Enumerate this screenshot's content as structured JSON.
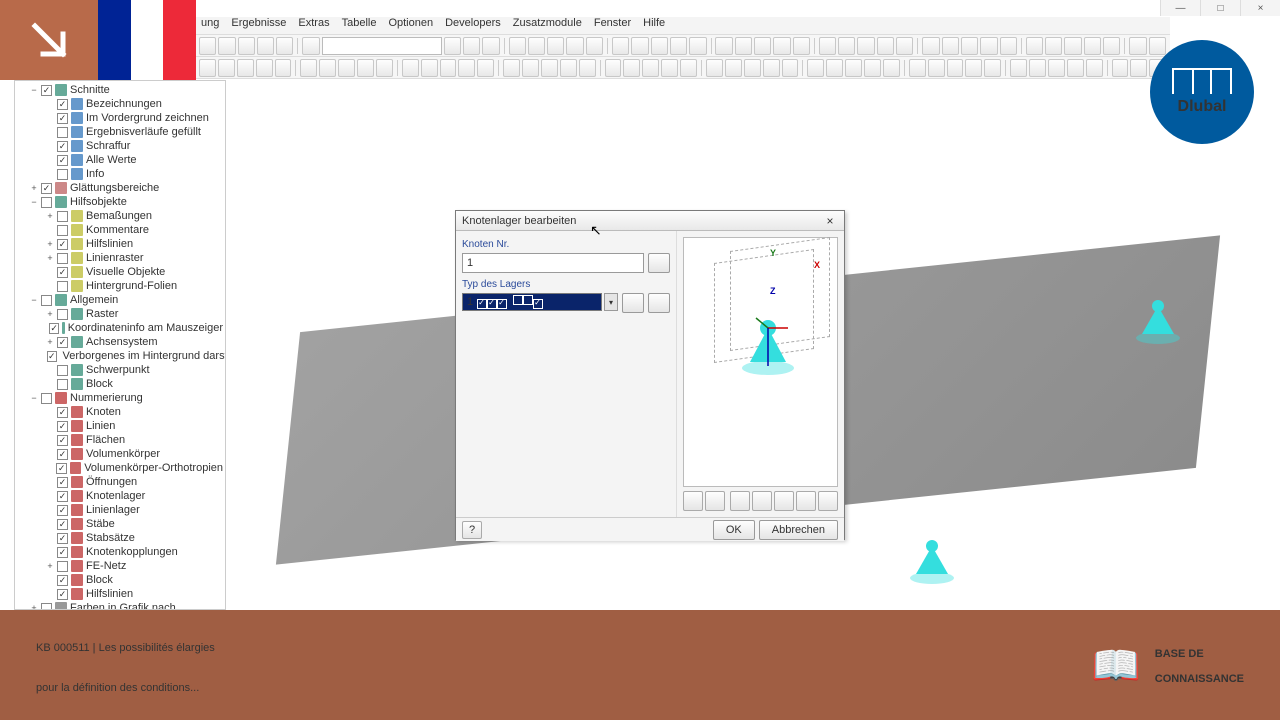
{
  "menu": [
    "ung",
    "Ergebnisse",
    "Extras",
    "Tabelle",
    "Optionen",
    "Developers",
    "Zusatzmodule",
    "Fenster",
    "Hilfe"
  ],
  "tree": [
    {
      "l": 1,
      "exp": "−",
      "chk": true,
      "ic": "ic-a",
      "label": "Schnitte"
    },
    {
      "l": 2,
      "chk": true,
      "ic": "ic-b",
      "label": "Bezeichnungen"
    },
    {
      "l": 2,
      "chk": true,
      "ic": "ic-b",
      "label": "Im Vordergrund zeichnen"
    },
    {
      "l": 2,
      "chk": false,
      "ic": "ic-b",
      "label": "Ergebnisverläufe gefüllt"
    },
    {
      "l": 2,
      "chk": true,
      "ic": "ic-b",
      "label": "Schraffur"
    },
    {
      "l": 2,
      "chk": true,
      "ic": "ic-b",
      "label": "Alle Werte"
    },
    {
      "l": 2,
      "chk": false,
      "ic": "ic-b",
      "label": "Info"
    },
    {
      "l": 1,
      "exp": "+",
      "chk": true,
      "ic": "ic-c",
      "label": "Glättungsbereiche"
    },
    {
      "l": 1,
      "exp": "−",
      "chk": false,
      "ic": "ic-a",
      "label": "Hilfsobjekte"
    },
    {
      "l": 2,
      "exp": "+",
      "chk": false,
      "ic": "ic-d",
      "label": "Bemaßungen"
    },
    {
      "l": 2,
      "exp": "",
      "chk": false,
      "ic": "ic-d",
      "label": "Kommentare"
    },
    {
      "l": 2,
      "exp": "+",
      "chk": true,
      "ic": "ic-d",
      "label": "Hilfslinien"
    },
    {
      "l": 2,
      "exp": "+",
      "chk": false,
      "ic": "ic-d",
      "label": "Linienraster"
    },
    {
      "l": 2,
      "exp": "",
      "chk": true,
      "ic": "ic-d",
      "label": "Visuelle Objekte"
    },
    {
      "l": 2,
      "exp": "",
      "chk": false,
      "ic": "ic-d",
      "label": "Hintergrund-Folien"
    },
    {
      "l": 1,
      "exp": "−",
      "chk": false,
      "ic": "ic-a",
      "label": "Allgemein"
    },
    {
      "l": 2,
      "exp": "+",
      "chk": false,
      "ic": "ic-a",
      "label": "Raster"
    },
    {
      "l": 2,
      "exp": "",
      "chk": true,
      "ic": "ic-a",
      "label": "Koordinateninfo am Mauszeiger"
    },
    {
      "l": 2,
      "exp": "+",
      "chk": true,
      "ic": "ic-a",
      "label": "Achsensystem"
    },
    {
      "l": 2,
      "exp": "",
      "chk": true,
      "ic": "ic-a",
      "label": "Verborgenes im Hintergrund darstelle"
    },
    {
      "l": 2,
      "exp": "",
      "chk": false,
      "ic": "ic-a",
      "label": "Schwerpunkt"
    },
    {
      "l": 2,
      "exp": "",
      "chk": false,
      "ic": "ic-a",
      "label": "Block"
    },
    {
      "l": 1,
      "exp": "−",
      "chk": false,
      "ic": "ic-n",
      "label": "Nummerierung"
    },
    {
      "l": 2,
      "chk": true,
      "ic": "ic-n",
      "label": "Knoten"
    },
    {
      "l": 2,
      "chk": true,
      "ic": "ic-n",
      "label": "Linien"
    },
    {
      "l": 2,
      "chk": true,
      "ic": "ic-n",
      "label": "Flächen"
    },
    {
      "l": 2,
      "chk": true,
      "ic": "ic-n",
      "label": "Volumenkörper"
    },
    {
      "l": 2,
      "chk": true,
      "ic": "ic-n",
      "label": "Volumenkörper-Orthotropien"
    },
    {
      "l": 2,
      "chk": true,
      "ic": "ic-n",
      "label": "Öffnungen"
    },
    {
      "l": 2,
      "chk": true,
      "ic": "ic-n",
      "label": "Knotenlager"
    },
    {
      "l": 2,
      "chk": true,
      "ic": "ic-n",
      "label": "Linienlager"
    },
    {
      "l": 2,
      "chk": true,
      "ic": "ic-n",
      "label": "Stäbe"
    },
    {
      "l": 2,
      "chk": true,
      "ic": "ic-n",
      "label": "Stabsätze"
    },
    {
      "l": 2,
      "chk": true,
      "ic": "ic-n",
      "label": "Knotenkopplungen"
    },
    {
      "l": 2,
      "exp": "+",
      "chk": false,
      "ic": "ic-n",
      "label": "FE-Netz"
    },
    {
      "l": 2,
      "chk": true,
      "ic": "ic-n",
      "label": "Block"
    },
    {
      "l": 2,
      "chk": true,
      "ic": "ic-n",
      "label": "Hilfslinien"
    },
    {
      "l": 1,
      "exp": "+",
      "chk": false,
      "ic": "ic-e",
      "label": "Farben in Grafik nach"
    }
  ],
  "dialog": {
    "title": "Knotenlager bearbeiten",
    "node_label": "Knoten Nr.",
    "node_value": "1",
    "type_label": "Typ des Lagers",
    "type_value": "1",
    "type_checks": [
      true,
      true,
      true,
      false,
      false,
      true
    ],
    "ok": "OK",
    "cancel": "Abbrechen",
    "help": "?"
  },
  "badge": {
    "brand": "Dlubal"
  },
  "overlay": {
    "title_line1": "KB 000511 | Les possibilités élargies",
    "title_line2": "pour la définition des conditions...",
    "kb_line1": "BASE DE",
    "kb_line2": "CONNAISSANCE",
    "book": "📖"
  },
  "flag": {
    "c1": "#002395",
    "c2": "#ffffff",
    "c3": "#ed2939"
  }
}
